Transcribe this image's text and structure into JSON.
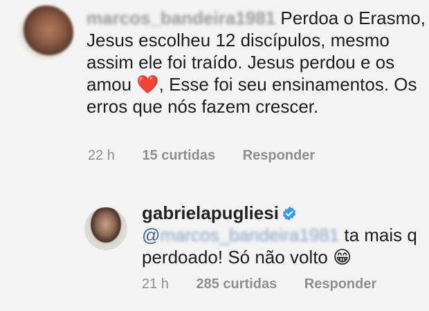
{
  "comment1": {
    "username": "marcos_bandeira1981",
    "text_after_username": " Perdoa o Erasmo, Jesus escolheu 12 discípulos, mesmo assim ele foi traído. Jesus perdou e os amou ",
    "emoji_heart": "❤️",
    "text_end": ", Esse foi seu ensinamentos. Os erros que nós fazem crescer.",
    "time": "22 h",
    "likes": "15 curtidas",
    "reply": "Responder"
  },
  "comment2": {
    "username": "gabrielapugliesi",
    "verified_icon": "verified-badge-icon",
    "mention_prefix": "@",
    "mention_name": "marcos_bandeira1981",
    "text": " ta mais q perdoado! Só não volto ",
    "emoji_grin": "😁",
    "time": "21 h",
    "likes": "285 curtidas",
    "reply": "Responder"
  },
  "colors": {
    "background": "#f4f4f4",
    "meta": "#8e8e8e",
    "verified": "#3897f0",
    "heart": "#d62b2b"
  }
}
